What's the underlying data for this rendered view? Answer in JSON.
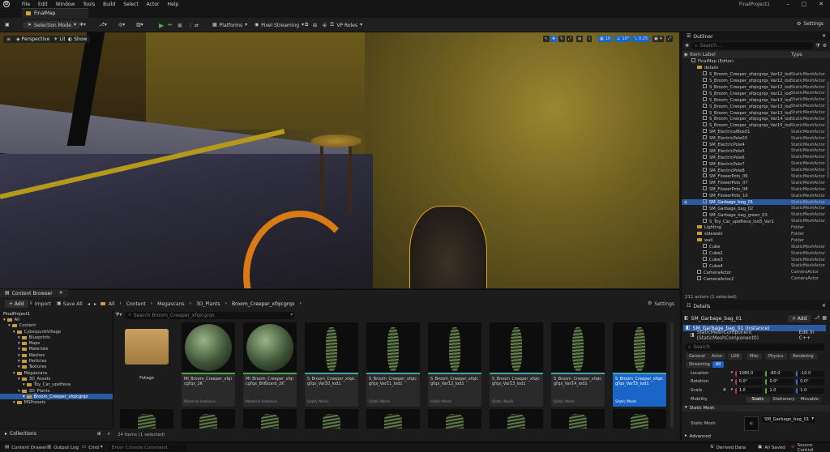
{
  "menubar": {
    "logo": "U",
    "items": [
      "File",
      "Edit",
      "Window",
      "Tools",
      "Build",
      "Select",
      "Actor",
      "Help"
    ],
    "project_title": "FinalProject1"
  },
  "level_tab": {
    "label": "FinalMap"
  },
  "toolbar": {
    "selection_mode": "Selection Mode",
    "platforms": "Platforms",
    "pixel_streaming": "Pixel Streaming",
    "vp_roles": "VP Roles",
    "settings": "Settings"
  },
  "viewport": {
    "perspective": "Perspective",
    "lit": "Lit",
    "show": "Show",
    "grid_snap": "10",
    "rot_snap": "10°",
    "scale_snap": "0.25",
    "cam_speed": "4"
  },
  "outliner": {
    "title": "Outliner",
    "search_placeholder": "Search...",
    "col_label": "Item Label",
    "col_type": "Type",
    "rows": [
      {
        "name": "FinalMap (Editor)",
        "type": "",
        "kind": "map",
        "indent": 0
      },
      {
        "name": "details",
        "type": "",
        "kind": "folder",
        "indent": 1
      },
      {
        "name": "S_Broom_Creeper_xfqicgrqx_Var12_lod",
        "type": "StaticMeshActor",
        "kind": "mesh",
        "indent": 2
      },
      {
        "name": "S_Broom_Creeper_xfqicgrqx_Var12_lod",
        "type": "StaticMeshActor",
        "kind": "mesh",
        "indent": 2
      },
      {
        "name": "S_Broom_Creeper_xfqicgrqx_Var12_lod",
        "type": "StaticMeshActor",
        "kind": "mesh",
        "indent": 2
      },
      {
        "name": "S_Broom_Creeper_xfqicgrqx_Var12_lod",
        "type": "StaticMeshActor",
        "kind": "mesh",
        "indent": 2
      },
      {
        "name": "S_Broom_Creeper_xfqicgrqx_Var13_lod",
        "type": "StaticMeshActor",
        "kind": "mesh",
        "indent": 2
      },
      {
        "name": "S_Broom_Creeper_xfqicgrqx_Var13_lod",
        "type": "StaticMeshActor",
        "kind": "mesh",
        "indent": 2
      },
      {
        "name": "S_Broom_Creeper_xfqicgrqx_Var13_lod",
        "type": "StaticMeshActor",
        "kind": "mesh",
        "indent": 2
      },
      {
        "name": "S_Broom_Creeper_xfqicgrqx_Var14_lod",
        "type": "StaticMeshActor",
        "kind": "mesh",
        "indent": 2
      },
      {
        "name": "S_Broom_Creeper_xfqicgrqx_Var15_lod",
        "type": "StaticMeshActor",
        "kind": "mesh",
        "indent": 2
      },
      {
        "name": "SM_ElectricalBox01",
        "type": "StaticMeshActor",
        "kind": "mesh",
        "indent": 2
      },
      {
        "name": "SM_ElectricPole03",
        "type": "StaticMeshActor",
        "kind": "mesh",
        "indent": 2
      },
      {
        "name": "SM_ElectricPole4",
        "type": "StaticMeshActor",
        "kind": "mesh",
        "indent": 2
      },
      {
        "name": "SM_ElectricPole5",
        "type": "StaticMeshActor",
        "kind": "mesh",
        "indent": 2
      },
      {
        "name": "SM_ElectricPole6",
        "type": "StaticMeshActor",
        "kind": "mesh",
        "indent": 2
      },
      {
        "name": "SM_ElectricPole7",
        "type": "StaticMeshActor",
        "kind": "mesh",
        "indent": 2
      },
      {
        "name": "SM_ElectricPole8",
        "type": "StaticMeshActor",
        "kind": "mesh",
        "indent": 2
      },
      {
        "name": "SM_FlowerPots_06",
        "type": "StaticMeshActor",
        "kind": "mesh",
        "indent": 2
      },
      {
        "name": "SM_FlowerPots_07",
        "type": "StaticMeshActor",
        "kind": "mesh",
        "indent": 2
      },
      {
        "name": "SM_FlowerPots_08",
        "type": "StaticMeshActor",
        "kind": "mesh",
        "indent": 2
      },
      {
        "name": "SM_FlowerPots_10",
        "type": "StaticMeshActor",
        "kind": "mesh",
        "indent": 2
      },
      {
        "name": "SM_Garbage_bag_01",
        "type": "StaticMeshActor",
        "kind": "mesh",
        "indent": 2,
        "selected": true
      },
      {
        "name": "SM_Garbage_bag_02",
        "type": "StaticMeshActor",
        "kind": "mesh",
        "indent": 2
      },
      {
        "name": "SM_Garbage_bag_green_03",
        "type": "StaticMeshActor",
        "kind": "mesh",
        "indent": 2
      },
      {
        "name": "S_Toy_Car_upefteva_lod3_Var1",
        "type": "StaticMeshActor",
        "kind": "mesh",
        "indent": 2
      },
      {
        "name": "Lighting",
        "type": "Folder",
        "kind": "folder",
        "indent": 1
      },
      {
        "name": "sidewalk",
        "type": "Folder",
        "kind": "folder",
        "indent": 1
      },
      {
        "name": "wall",
        "type": "Folder",
        "kind": "folder",
        "indent": 1
      },
      {
        "name": "Cube",
        "type": "StaticMeshActor",
        "kind": "mesh",
        "indent": 2
      },
      {
        "name": "Cube2",
        "type": "StaticMeshActor",
        "kind": "mesh",
        "indent": 2
      },
      {
        "name": "Cube3",
        "type": "StaticMeshActor",
        "kind": "mesh",
        "indent": 2
      },
      {
        "name": "Cube4",
        "type": "StaticMeshActor",
        "kind": "mesh",
        "indent": 2
      },
      {
        "name": "CameraActor",
        "type": "CameraActor",
        "kind": "mesh",
        "indent": 1
      },
      {
        "name": "CameraActor2",
        "type": "CameraActor",
        "kind": "mesh",
        "indent": 1
      }
    ],
    "count": "211 actors (1 selected)"
  },
  "details": {
    "title": "Details",
    "actor_name": "SM_Garbage_bag_01",
    "add": "+ Add",
    "instance": "SM_Garbage_bag_01 (Instance)",
    "component": "StaticMeshComponent (StaticMeshComponent0)",
    "edit_in": "Edit in C++",
    "search_placeholder": "Search",
    "tabs": [
      "General",
      "Actor",
      "LOD",
      "Misc",
      "Physics",
      "Rendering",
      "Streaming",
      "All"
    ],
    "location_label": "Location",
    "location": [
      "1080.0",
      "-80.0",
      "-10.0"
    ],
    "rotation_label": "Rotation",
    "rotation": [
      "0.0°",
      "0.0°",
      "0.0°"
    ],
    "scale_label": "Scale",
    "scale": [
      "1.0",
      "1.0",
      "1.0"
    ],
    "mobility_label": "Mobility",
    "mobility": [
      "Static",
      "Stationary",
      "Movable"
    ],
    "section_static_mesh": "Static Mesh",
    "static_mesh_label": "Static Mesh",
    "static_mesh_value": "SM_Garbage_bag_01",
    "section_advanced": "Advanced"
  },
  "content_browser": {
    "tab": "Content Browser",
    "add": "+ Add",
    "import": "Import",
    "save_all": "Save All",
    "breadcrumb": [
      "All",
      "Content",
      "Megascans",
      "3D_Plants",
      "Broom_Creeper_xfqicgrqx"
    ],
    "settings": "Settings",
    "search_placeholder": "Search Broom_Creeper_xfqicgrqx",
    "tree": [
      {
        "name": "FinalProject1",
        "indent": 0,
        "kind": "root"
      },
      {
        "name": "All",
        "indent": 0,
        "kind": "folder"
      },
      {
        "name": "Content",
        "indent": 1,
        "kind": "folder"
      },
      {
        "name": "CyberpunkVillage",
        "indent": 2,
        "kind": "folder"
      },
      {
        "name": "Blueprints",
        "indent": 3,
        "kind": "folder"
      },
      {
        "name": "Maps",
        "indent": 3,
        "kind": "folder"
      },
      {
        "name": "Materials",
        "indent": 3,
        "kind": "folder"
      },
      {
        "name": "Meshes",
        "indent": 3,
        "kind": "folder"
      },
      {
        "name": "Particles",
        "indent": 3,
        "kind": "folder"
      },
      {
        "name": "Textures",
        "indent": 3,
        "kind": "folder"
      },
      {
        "name": "Megascans",
        "indent": 2,
        "kind": "folder"
      },
      {
        "name": "3D_Assets",
        "indent": 3,
        "kind": "folder"
      },
      {
        "name": "Toy_Car_upefteva",
        "indent": 4,
        "kind": "folder"
      },
      {
        "name": "3D_Plants",
        "indent": 3,
        "kind": "folder"
      },
      {
        "name": "Broom_Creeper_xfqicgrqx",
        "indent": 4,
        "kind": "folder",
        "selected": true
      },
      {
        "name": "MSPresets",
        "indent": 2,
        "kind": "folder"
      }
    ],
    "assets": [
      {
        "name": "Foliage",
        "type": "",
        "kind": "folder"
      },
      {
        "name": "MI_Broom_Creeper_xfqicgrqx_2K",
        "type": "Material Instance",
        "kind": "sphere"
      },
      {
        "name": "MI_Broom_Creeper_xfqicgrqx_Billboard_2K",
        "type": "Material Instance",
        "kind": "sphere"
      },
      {
        "name": "S_Broom_Creeper_xfqicgrqx_Var10_lod1",
        "type": "Static Mesh",
        "kind": "plant"
      },
      {
        "name": "S_Broom_Creeper_xfqicgrqx_Var11_lod1",
        "type": "Static Mesh",
        "kind": "plant"
      },
      {
        "name": "S_Broom_Creeper_xfqicgrqx_Var12_lod1",
        "type": "Static Mesh",
        "kind": "plant"
      },
      {
        "name": "S_Broom_Creeper_xfqicgrqx_Var13_lod1",
        "type": "Static Mesh",
        "kind": "plant"
      },
      {
        "name": "S_Broom_Creeper_xfqicgrqx_Var14_lod1",
        "type": "Static Mesh",
        "kind": "plant"
      },
      {
        "name": "S_Broom_Creeper_xfqicgrqx_Var15_lod1",
        "type": "Static Mesh",
        "kind": "plant",
        "selected": true
      }
    ],
    "status": "24 items (1 selected)",
    "collections": "Collections"
  },
  "statusbar": {
    "content_drawer": "Content Drawer",
    "output_log": "Output Log",
    "cmd": "Cmd",
    "console_placeholder": "Enter Console Command",
    "derived_data": "Derived Data",
    "all_saved": "All Saved",
    "source_control": "Source Control"
  },
  "colors": {
    "accent": "#1a66c8",
    "selection_row": "#2c5aa0",
    "play_green": "#3cb64b",
    "folder": "#c79a3a",
    "selection_outline": "#e6a215"
  }
}
